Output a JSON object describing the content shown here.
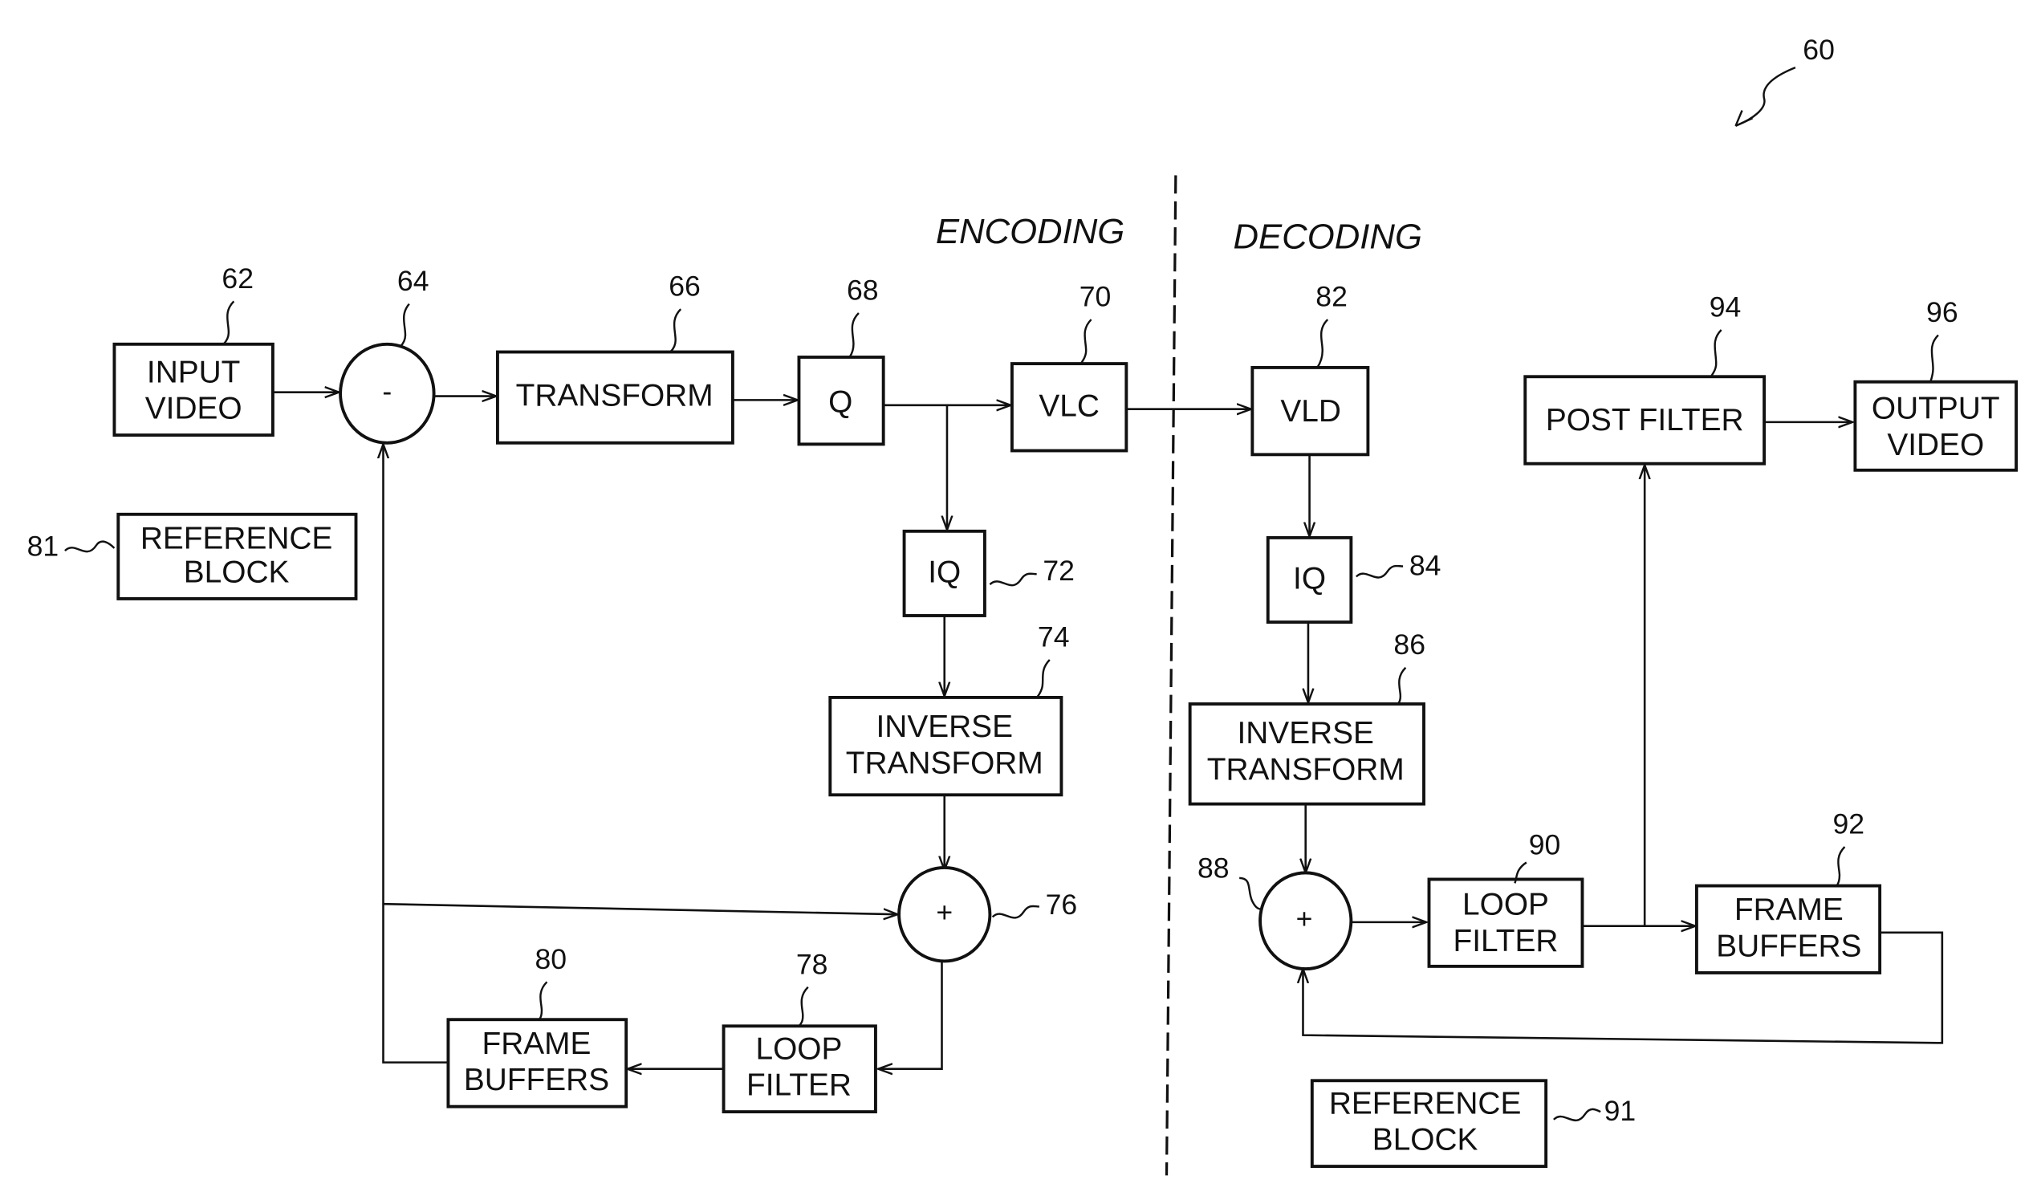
{
  "figure": {
    "ref": "60",
    "sections": {
      "encoding": "ENCODING",
      "decoding": "DECODING"
    }
  },
  "blocks": {
    "input_video": {
      "ref": "62",
      "lines": [
        "INPUT",
        "VIDEO"
      ]
    },
    "subtractor": {
      "ref": "64",
      "symbol": "-"
    },
    "transform": {
      "ref": "66",
      "lines": [
        "TRANSFORM"
      ]
    },
    "quantizer": {
      "ref": "68",
      "lines": [
        "Q"
      ]
    },
    "vlc": {
      "ref": "70",
      "lines": [
        "VLC"
      ]
    },
    "iq_enc": {
      "ref": "72",
      "lines": [
        "IQ"
      ]
    },
    "inv_transform_enc": {
      "ref": "74",
      "lines": [
        "INVERSE",
        "TRANSFORM"
      ]
    },
    "adder_enc": {
      "ref": "76",
      "symbol": "+"
    },
    "loop_filter_enc": {
      "ref": "78",
      "lines": [
        "LOOP",
        "FILTER"
      ]
    },
    "frame_buffers_enc": {
      "ref": "80",
      "lines": [
        "FRAME",
        "BUFFERS"
      ]
    },
    "reference_block_enc": {
      "ref": "81",
      "lines": [
        "REFERENCE",
        "BLOCK"
      ]
    },
    "vld": {
      "ref": "82",
      "lines": [
        "VLD"
      ]
    },
    "iq_dec": {
      "ref": "84",
      "lines": [
        "IQ"
      ]
    },
    "inv_transform_dec": {
      "ref": "86",
      "lines": [
        "INVERSE",
        "TRANSFORM"
      ]
    },
    "adder_dec": {
      "ref": "88",
      "symbol": "+"
    },
    "loop_filter_dec": {
      "ref": "90",
      "lines": [
        "LOOP",
        "FILTER"
      ]
    },
    "reference_block_dec": {
      "ref": "91",
      "lines": [
        "REFERENCE",
        "BLOCK"
      ]
    },
    "frame_buffers_dec": {
      "ref": "92",
      "lines": [
        "FRAME",
        "BUFFERS"
      ]
    },
    "post_filter": {
      "ref": "94",
      "lines": [
        "POST FILTER"
      ]
    },
    "output_video": {
      "ref": "96",
      "lines": [
        "OUTPUT",
        "VIDEO"
      ]
    }
  }
}
